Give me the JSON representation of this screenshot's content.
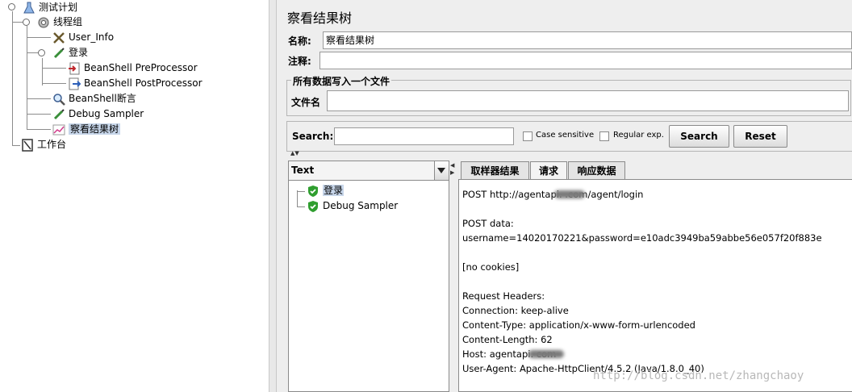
{
  "tree": {
    "items": [
      {
        "label": "测试计划",
        "icon": "flask-icon"
      },
      {
        "label": "线程组",
        "icon": "gear-icon"
      },
      {
        "label": "User_Info",
        "icon": "tools-icon"
      },
      {
        "label": "登录",
        "icon": "pipette-icon"
      },
      {
        "label": "BeanShell PreProcessor",
        "icon": "pre-processor-icon"
      },
      {
        "label": "BeanShell PostProcessor",
        "icon": "post-processor-icon"
      },
      {
        "label": "BeanShell断言",
        "icon": "magnifier-icon"
      },
      {
        "label": "Debug Sampler",
        "icon": "pipette-icon"
      },
      {
        "label": "察看结果树",
        "icon": "chart-icon"
      },
      {
        "label": "工作台",
        "icon": "workbench-icon"
      }
    ]
  },
  "panel": {
    "title": "察看结果树",
    "name_label": "名称:",
    "name_value": "察看结果树",
    "comment_label": "注释:",
    "comment_value": "",
    "file_group_title": "所有数据写入一个文件",
    "filename_label": "文件名",
    "filename_value": ""
  },
  "search": {
    "label": "Search:",
    "value": "",
    "case_sensitive": "Case sensitive",
    "regular_exp": "Regular exp.",
    "search_button": "Search",
    "reset_button": "Reset"
  },
  "results": {
    "renderer": "Text",
    "items": [
      {
        "label": "登录",
        "status": "success"
      },
      {
        "label": "Debug Sampler",
        "status": "success"
      }
    ]
  },
  "tabs": [
    {
      "label": "取样器结果",
      "active": false
    },
    {
      "label": "请求",
      "active": true
    },
    {
      "label": "响应数据",
      "active": false
    }
  ],
  "request_text": [
    "POST http://agentapi.        .com/agent/login",
    "",
    "POST data:",
    "username=14020170221&password=e10adc3949ba59abbe56e057f20f883e",
    "",
    "[no cookies]",
    "",
    "Request Headers:",
    "Connection: keep-alive",
    "Content-Type: application/x-www-form-urlencoded",
    "Content-Length: 62",
    "Host: agentapi.       com",
    "User-Agent: Apache-HttpClient/4.5.2 (Java/1.8.0_40)"
  ],
  "watermark": "http://blog.csdn.net/zhangchaoy"
}
